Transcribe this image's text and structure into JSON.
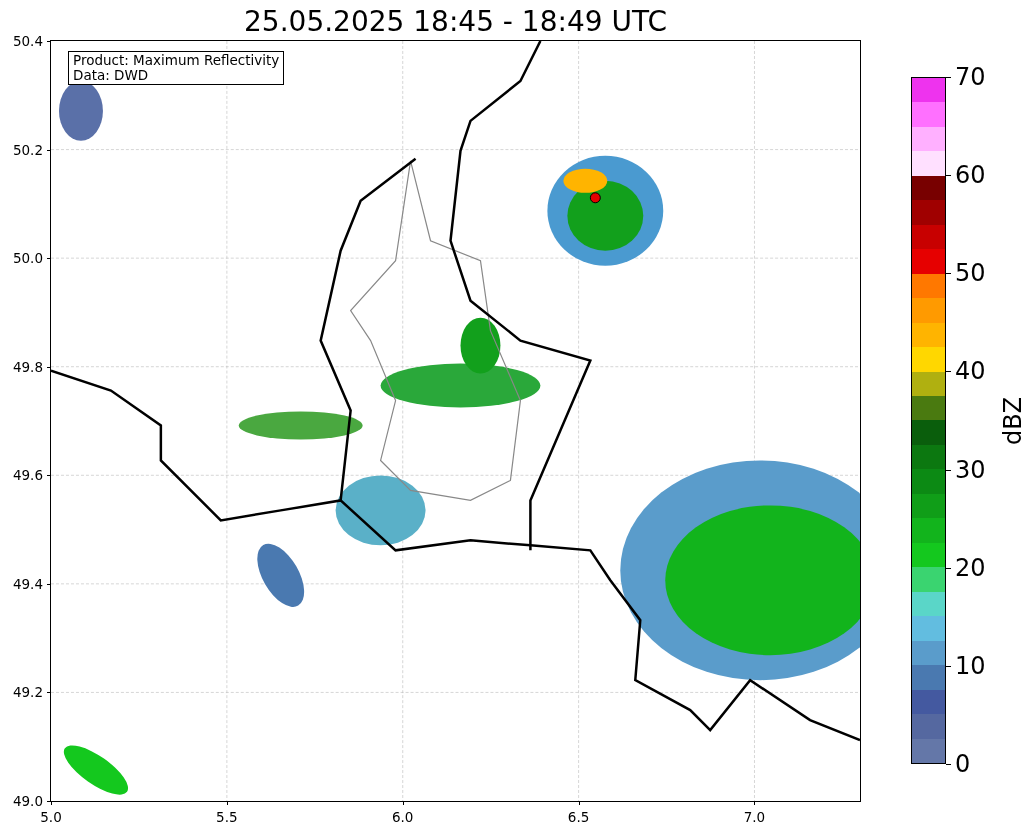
{
  "title": "25.05.2025 18:45 - 18:49 UTC",
  "map": {
    "info_lines": [
      "Product: Maximum Reflectivity",
      "Data: DWD"
    ],
    "xticks": [
      "5.0",
      "5.5",
      "6.0",
      "6.5",
      "7.0"
    ],
    "yticks": [
      "50.4",
      "50.2",
      "50.0",
      "49.8",
      "49.6",
      "49.4",
      "49.2",
      "49.0"
    ]
  },
  "colorbar": {
    "label": "dBZ",
    "ticks": [
      "70",
      "60",
      "50",
      "40",
      "30",
      "20",
      "10",
      "0"
    ],
    "segments": [
      {
        "color": "#6477a8"
      },
      {
        "color": "#5568a0"
      },
      {
        "color": "#4459a0"
      },
      {
        "color": "#4a79b0"
      },
      {
        "color": "#5a9ccb"
      },
      {
        "color": "#62bde0"
      },
      {
        "color": "#5ad6c8"
      },
      {
        "color": "#3ad470"
      },
      {
        "color": "#14c81e"
      },
      {
        "color": "#12b41c"
      },
      {
        "color": "#109e18"
      },
      {
        "color": "#0c8a14"
      },
      {
        "color": "#0c7810"
      },
      {
        "color": "#0a5e0c"
      },
      {
        "color": "#4a7a10"
      },
      {
        "color": "#b0b010"
      },
      {
        "color": "#ffd700"
      },
      {
        "color": "#ffb400"
      },
      {
        "color": "#ff9a00"
      },
      {
        "color": "#ff7800"
      },
      {
        "color": "#e60000"
      },
      {
        "color": "#c80000"
      },
      {
        "color": "#a00000"
      },
      {
        "color": "#780000"
      },
      {
        "color": "#ffe0ff"
      },
      {
        "color": "#ffb0ff"
      },
      {
        "color": "#ff70ff"
      },
      {
        "color": "#ee33ee"
      }
    ]
  }
}
